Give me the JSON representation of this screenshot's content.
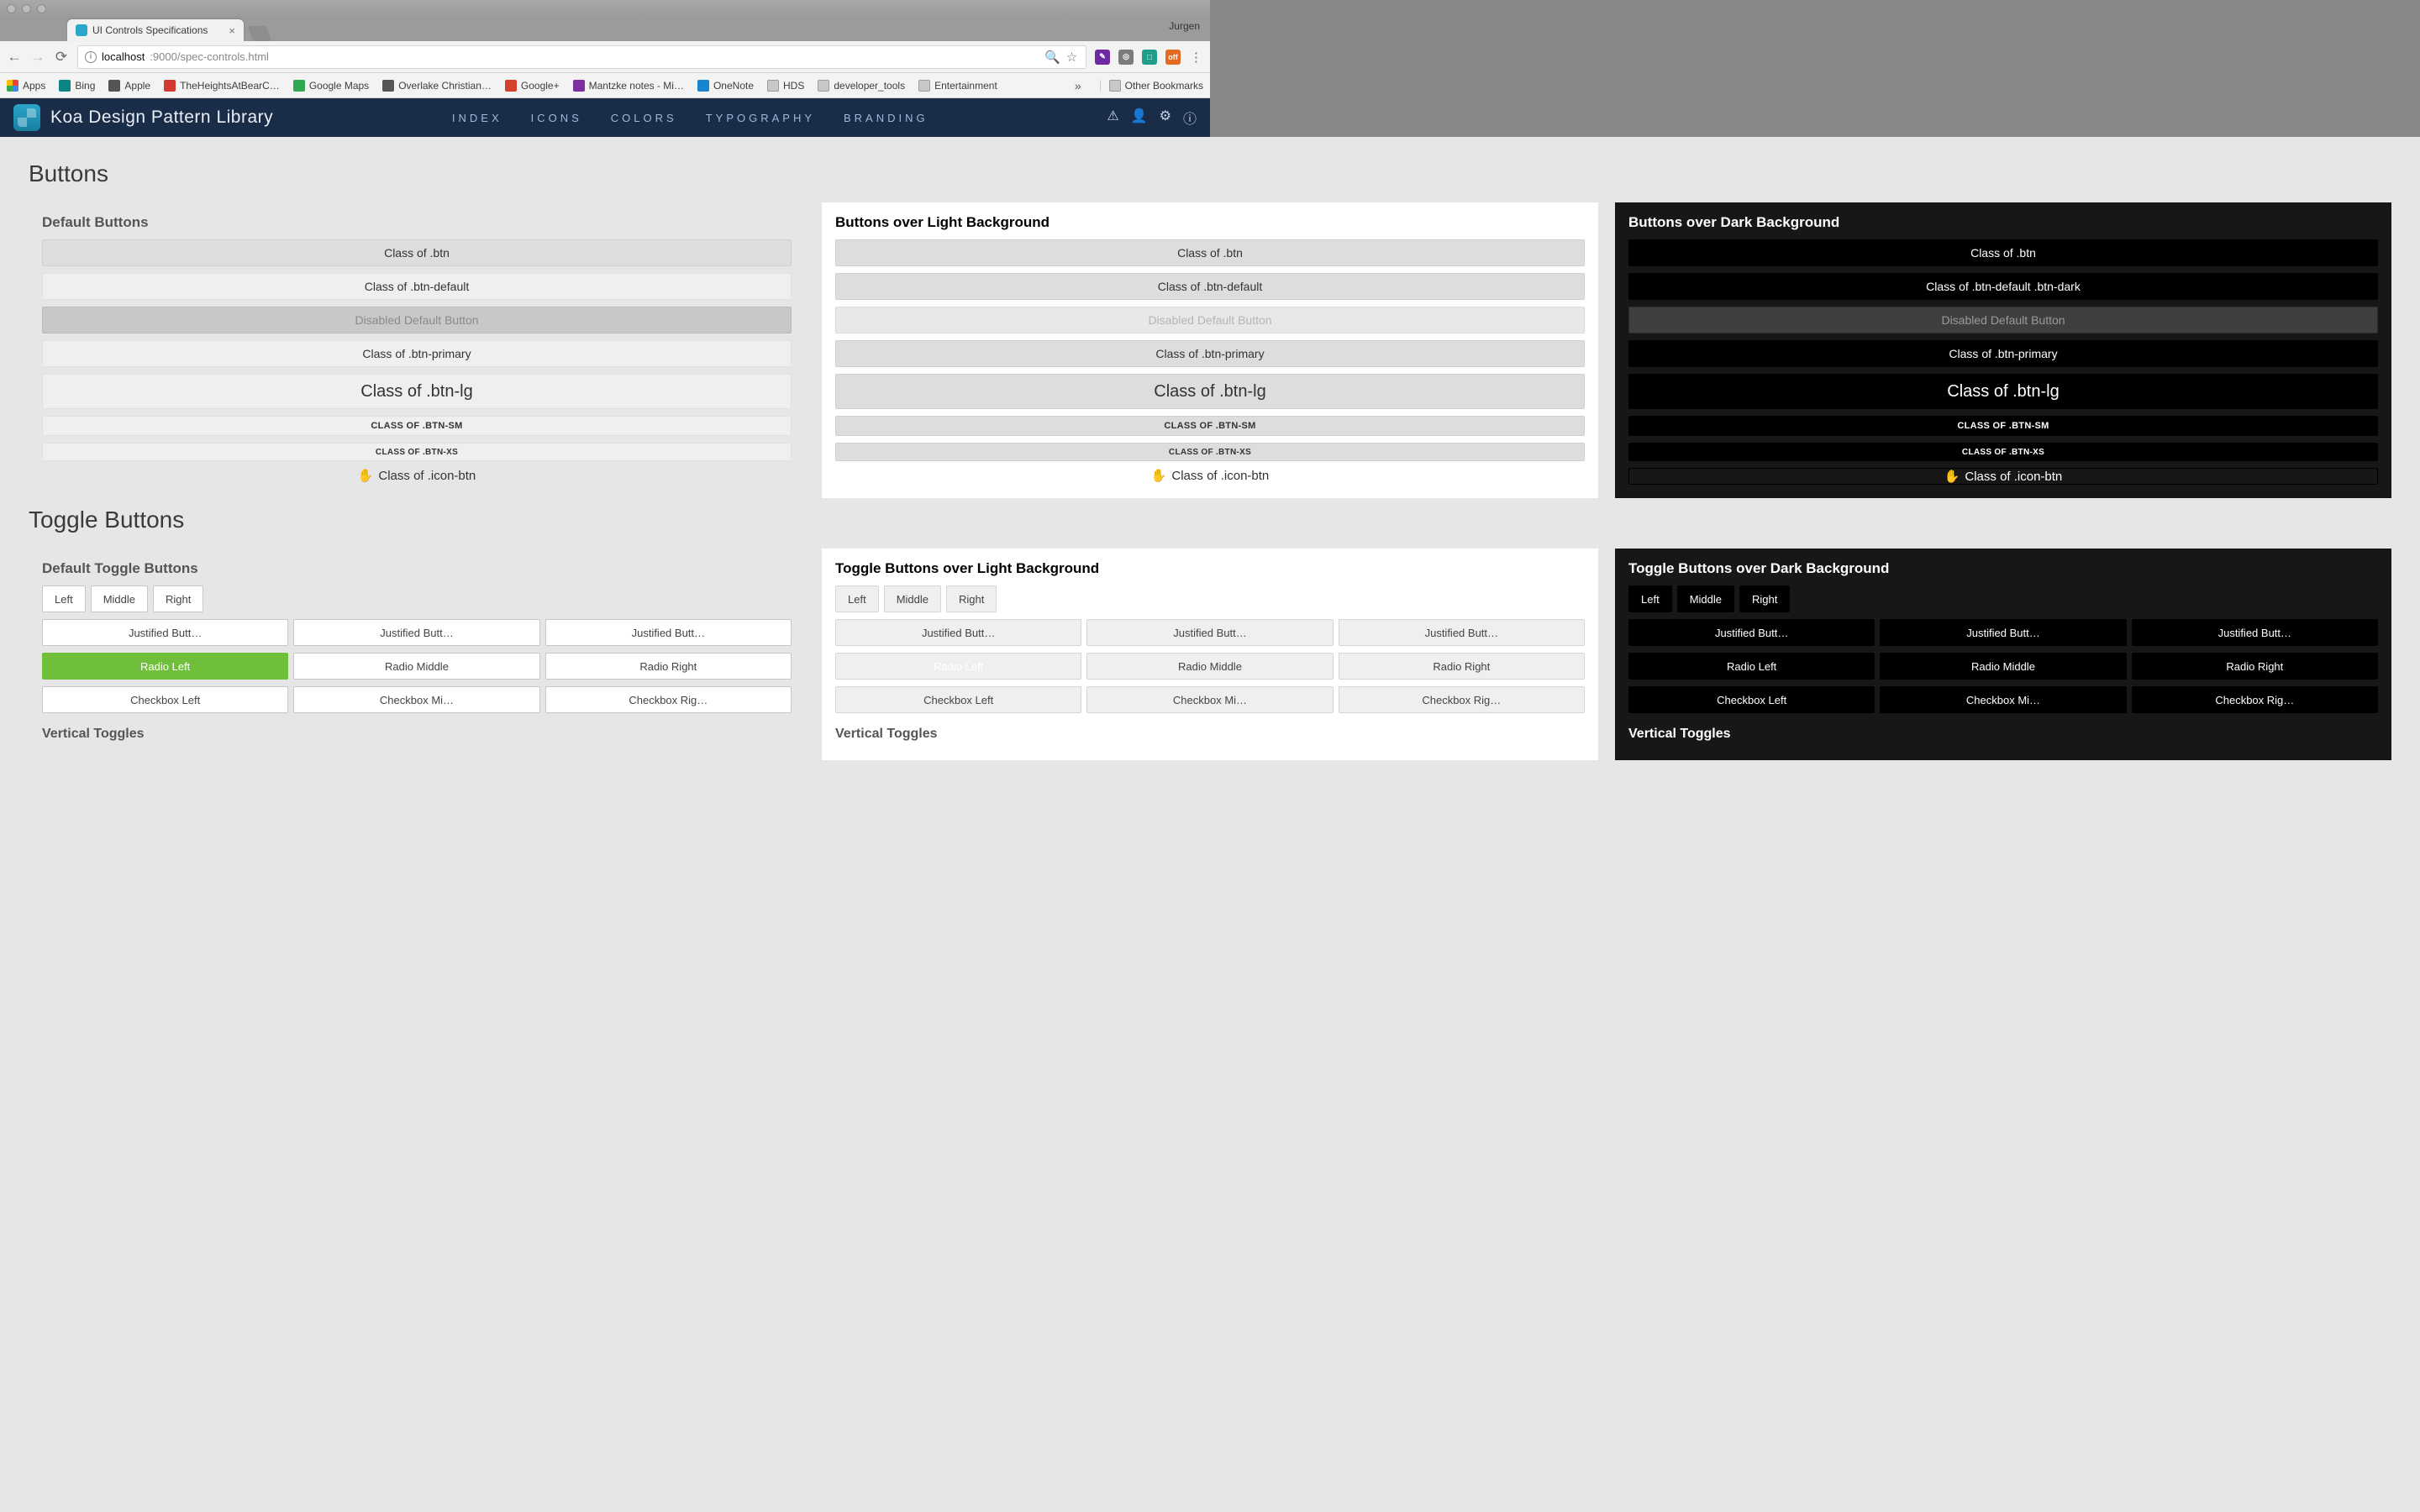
{
  "window": {
    "profile": "Jurgen",
    "tab_title": "UI Controls Specifications",
    "url_host": "localhost",
    "url_port_path": ":9000/spec-controls.html"
  },
  "bookmarks": [
    {
      "label": "Apps",
      "icon": "grid",
      "color": "#4285f4"
    },
    {
      "label": "Bing",
      "icon": "b",
      "color": "#0b8484"
    },
    {
      "label": "Apple",
      "icon": "apple",
      "color": "#555"
    },
    {
      "label": "TheHeightsAtBearC…",
      "icon": "sq",
      "color": "#d23a2f"
    },
    {
      "label": "Google Maps",
      "icon": "pin",
      "color": "#2fa84f"
    },
    {
      "label": "Overlake Christian…",
      "icon": "loop",
      "color": "#555"
    },
    {
      "label": "Google+",
      "icon": "g",
      "color": "#d5402c"
    },
    {
      "label": "Mantzke notes - Mi…",
      "icon": "n",
      "color": "#7b2fa0"
    },
    {
      "label": "OneNote",
      "icon": "cloud",
      "color": "#1785d0"
    },
    {
      "label": "HDS",
      "icon": "folder",
      "color": ""
    },
    {
      "label": "developer_tools",
      "icon": "folder",
      "color": ""
    },
    {
      "label": "Entertainment",
      "icon": "folder",
      "color": ""
    }
  ],
  "bookmarks_other": "Other Bookmarks",
  "nav": {
    "brand": "Koa Design Pattern Library",
    "links": [
      "INDEX",
      "ICONS",
      "COLORS",
      "TYPOGRAPHY",
      "BRANDING"
    ]
  },
  "sections": {
    "buttons_title": "Buttons",
    "toggles_title": "Toggle Buttons"
  },
  "button_cards": [
    {
      "title": "Default Buttons",
      "btns": {
        "btn": "Class of .btn",
        "default": "Class of .btn-default",
        "disabled": "Disabled Default Button",
        "primary": "Class of .btn-primary",
        "lg": "Class of .btn-lg",
        "sm": "CLASS OF .BTN-SM",
        "xs": "CLASS OF .BTN-XS",
        "icon": "Class of .icon-btn"
      }
    },
    {
      "title": "Buttons over Light Background",
      "btns": {
        "btn": "Class of .btn",
        "default": "Class of .btn-default",
        "disabled": "Disabled Default Button",
        "primary": "Class of .btn-primary",
        "lg": "Class of .btn-lg",
        "sm": "CLASS OF .BTN-SM",
        "xs": "CLASS OF .BTN-XS",
        "icon": "Class of .icon-btn"
      }
    },
    {
      "title": "Buttons over Dark Background",
      "btns": {
        "btn": "Class of .btn",
        "default": "Class of .btn-default .btn-dark",
        "disabled": "Disabled Default Button",
        "primary": "Class of .btn-primary",
        "lg": "Class of .btn-lg",
        "sm": "CLASS OF .BTN-SM",
        "xs": "CLASS OF .BTN-XS",
        "icon": "Class of .icon-btn"
      }
    }
  ],
  "toggle_cards": [
    {
      "title": "Default Toggle Buttons",
      "lmr": [
        "Left",
        "Middle",
        "Right"
      ],
      "just": [
        "Justified Butt…",
        "Justified Butt…",
        "Justified Butt…"
      ],
      "radio": [
        "Radio Left",
        "Radio Middle",
        "Radio Right"
      ],
      "check": [
        "Checkbox Left",
        "Checkbox Mi…",
        "Checkbox Rig…"
      ],
      "vertical": "Vertical Toggles"
    },
    {
      "title": "Toggle Buttons over Light Background",
      "lmr": [
        "Left",
        "Middle",
        "Right"
      ],
      "just": [
        "Justified Butt…",
        "Justified Butt…",
        "Justified Butt…"
      ],
      "radio": [
        "Radio Left",
        "Radio Middle",
        "Radio Right"
      ],
      "check": [
        "Checkbox Left",
        "Checkbox Mi…",
        "Checkbox Rig…"
      ],
      "vertical": "Vertical Toggles"
    },
    {
      "title": "Toggle Buttons over Dark Background",
      "lmr": [
        "Left",
        "Middle",
        "Right"
      ],
      "just": [
        "Justified Butt…",
        "Justified Butt…",
        "Justified Butt…"
      ],
      "radio": [
        "Radio Left",
        "Radio Middle",
        "Radio Right"
      ],
      "check": [
        "Checkbox Left",
        "Checkbox Mi…",
        "Checkbox Rig…"
      ],
      "vertical": "Vertical Toggles"
    }
  ]
}
